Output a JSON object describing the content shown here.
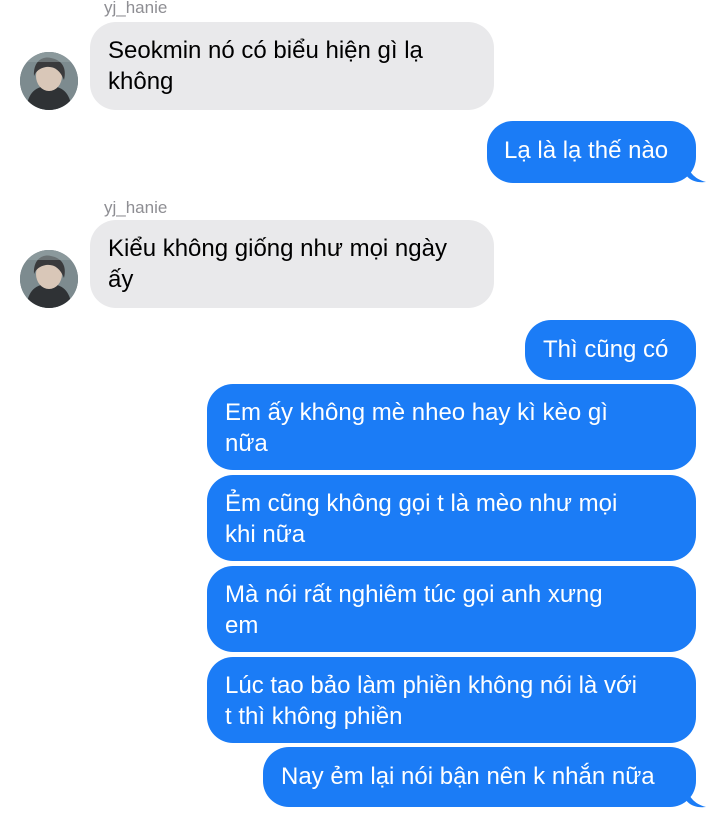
{
  "colors": {
    "incoming_bubble": "#e9e9eb",
    "outgoing_bubble": "#1b7cf6",
    "sender_name": "#8e8e93"
  },
  "messages": [
    {
      "direction": "in",
      "sender": "yj_hanie",
      "text": "Seokmin nó có biểu hiện gì lạ\nkhông"
    },
    {
      "direction": "out",
      "text": "Lạ là lạ thế nào"
    },
    {
      "direction": "in",
      "sender": "yj_hanie",
      "text": "Kiểu không giống như mọi ngày\nấy"
    },
    {
      "direction": "out",
      "text": "Thì cũng có"
    },
    {
      "direction": "out",
      "text": "Em ấy không mè nheo hay kì kèo gì\nnữa"
    },
    {
      "direction": "out",
      "text": "Ẻm cũng không gọi t là mèo như mọi\nkhi nữa"
    },
    {
      "direction": "out",
      "text": "Mà nói rất nghiêm túc gọi anh xưng\nem"
    },
    {
      "direction": "out",
      "text": "Lúc tao bảo làm phiền không nói là với\nt thì không phiền"
    },
    {
      "direction": "out",
      "text": "Nay ẻm lại nói bận nên k nhắn nữa"
    }
  ],
  "avatar_icon": "profile-photo-avatar"
}
